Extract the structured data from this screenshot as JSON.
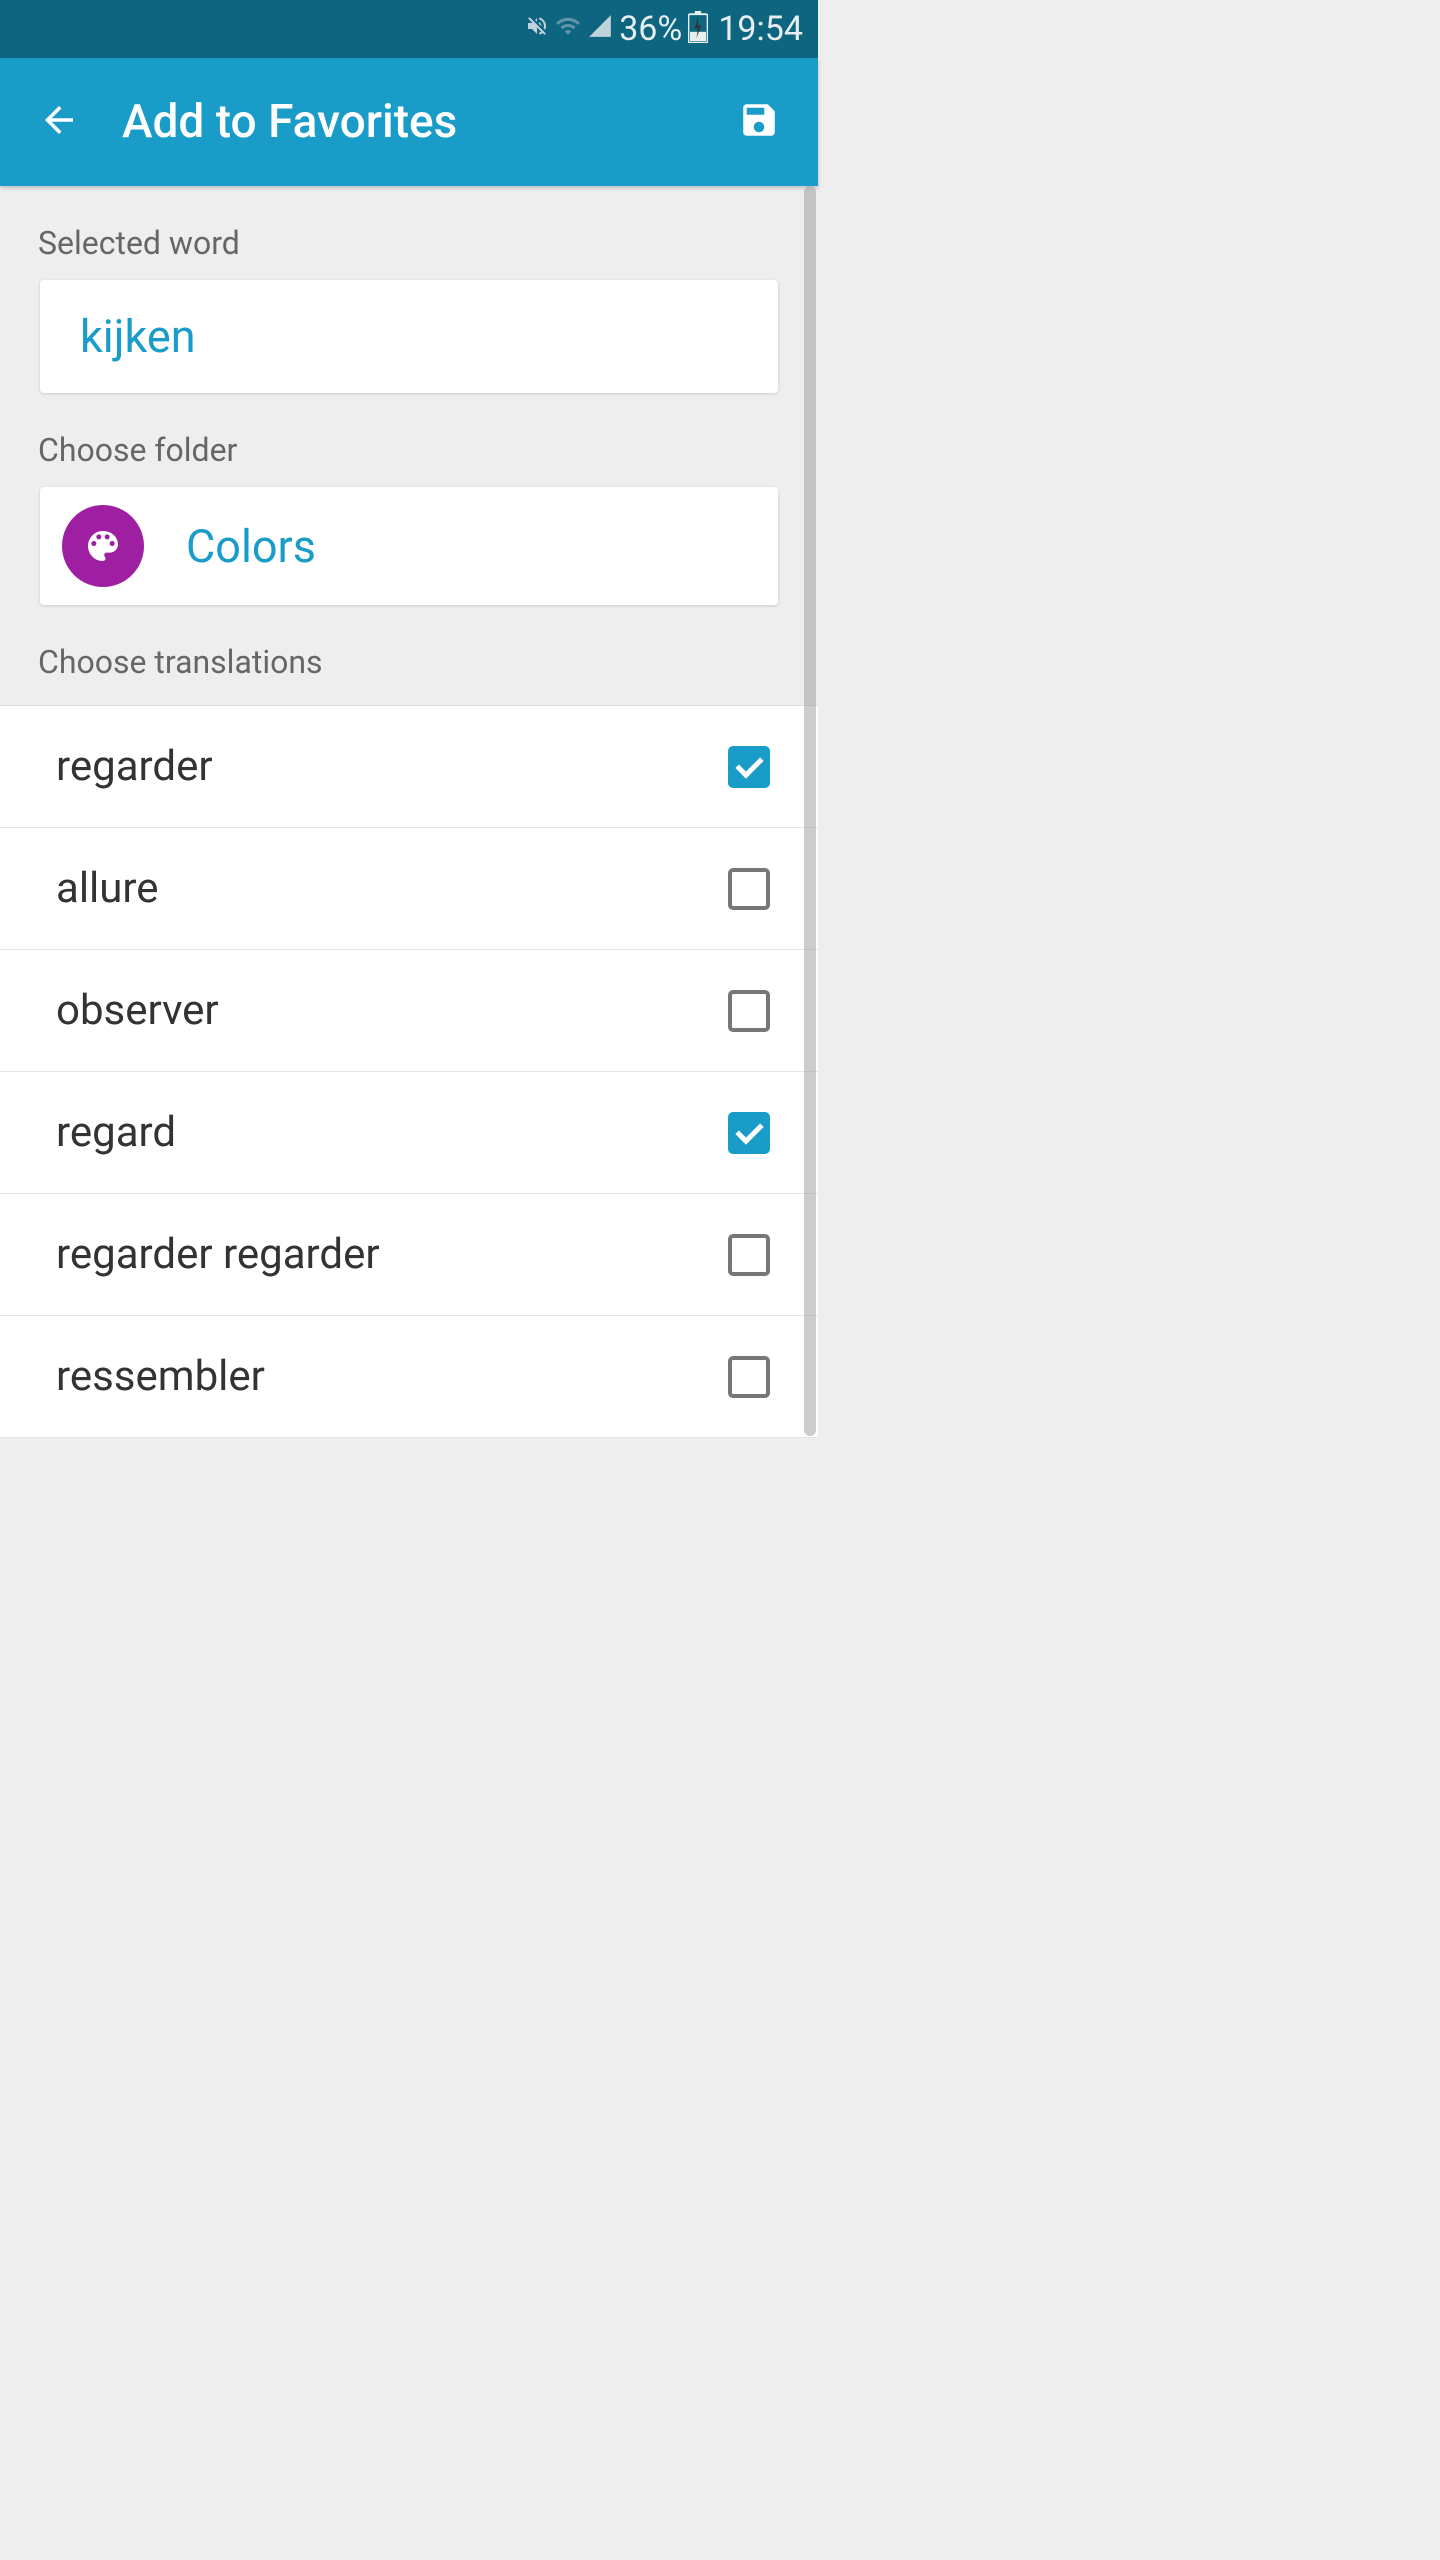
{
  "statusBar": {
    "battery": "36%",
    "time": "19:54"
  },
  "appBar": {
    "title": "Add to Favorites"
  },
  "sections": {
    "selectedWordLabel": "Selected word",
    "selectedWord": "kijken",
    "chooseFolderLabel": "Choose folder",
    "folderName": "Colors",
    "chooseTranslationsLabel": "Choose translations"
  },
  "translations": [
    {
      "text": "regarder",
      "checked": true
    },
    {
      "text": "allure",
      "checked": false
    },
    {
      "text": "observer",
      "checked": false
    },
    {
      "text": "regard",
      "checked": true
    },
    {
      "text": "regarder regarder",
      "checked": false
    },
    {
      "text": "ressembler",
      "checked": false
    }
  ]
}
